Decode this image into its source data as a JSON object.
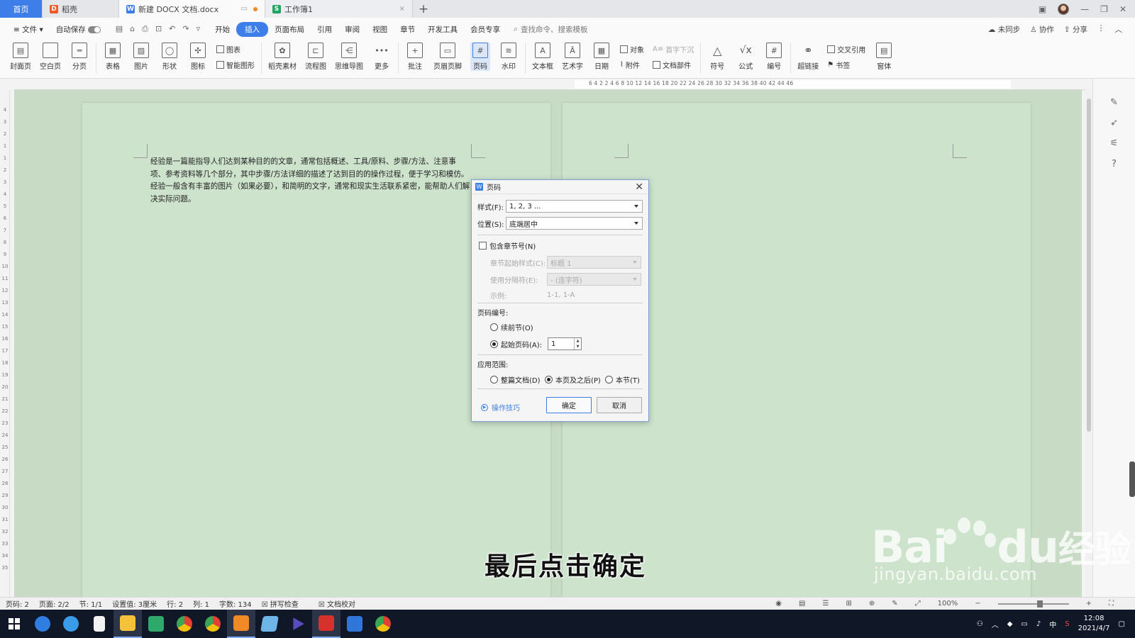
{
  "tabs": {
    "home": "首页",
    "straw": "稻壳",
    "doc": "新建 DOCX 文档.docx",
    "sheet": "工作簿1"
  },
  "menubar": {
    "file": "文件",
    "autosave": "自动保存",
    "items": [
      "开始",
      "插入",
      "页面布局",
      "引用",
      "审阅",
      "视图",
      "章节",
      "开发工具",
      "会员专享"
    ],
    "active_index": 1,
    "search_placeholder": "查找命令、搜索模板",
    "unsync": "未同步",
    "collab": "协作",
    "share": "分享"
  },
  "ribbon": {
    "cover": "封面页",
    "blank": "空白页",
    "pagebreak": "分页",
    "table": "表格",
    "picture": "图片",
    "shape": "形状",
    "icon": "图标",
    "chart": "图表",
    "smartart": "智能图形",
    "material": "稻壳素材",
    "flow": "流程图",
    "mindmap": "思维导图",
    "more": "更多",
    "comment": "批注",
    "header_footer": "页眉页脚",
    "page_number": "页码",
    "watermark": "水印",
    "textbox": "文本框",
    "wordart": "艺术字",
    "date": "日期",
    "object": "对象",
    "attachment": "附件",
    "dropcap": "首字下沉",
    "docparts": "文档部件",
    "symbol": "符号",
    "formula": "公式",
    "numbering": "编号",
    "hyperlink": "超链接",
    "crossref": "交叉引用",
    "bookmark": "书签",
    "window": "窗体"
  },
  "ruler": {
    "h_numbers": "6 4 2 2 4 6 8 10 12 14 16 18 20 22 24 26 28 30 32 34 36 38 40 42 44 46",
    "v_numbers": [
      "4",
      "3",
      "2",
      "1",
      "",
      "1",
      "2",
      "3",
      "4",
      "5",
      "6",
      "7",
      "8",
      "9",
      "10",
      "11",
      "12",
      "13",
      "14",
      "15",
      "16",
      "17",
      "18",
      "19",
      "20",
      "21",
      "22",
      "23",
      "24",
      "25",
      "26",
      "27",
      "28",
      "29",
      "30",
      "31",
      "32",
      "33",
      "34",
      "35"
    ]
  },
  "document": {
    "paragraph": "经验是一篇能指导人们达到某种目的的文章，通常包括概述、工具/原料、步骤/方法、注意事项、参考资料等几个部分，其中步骤/方法详细的描述了达到目的的操作过程，便于学习和模仿。经验一般含有丰富的图片（如果必要），和简明的文字，通常和现实生活联系紧密，能帮助人们解决实际问题。"
  },
  "dialog": {
    "title": "页码",
    "style_label": "样式(F):",
    "style_value": "1, 2, 3 ...",
    "position_label": "位置(S):",
    "position_value": "底端居中",
    "include_chapter": "包含章节号(N)",
    "chapter_style_label": "章节起始样式(C):",
    "chapter_style_value": "标题 1",
    "separator_label": "使用分隔符(E):",
    "separator_value": "-  (连字符)",
    "example_label": "示例:",
    "example_value": "1-1, 1-A",
    "numbering_label": "页码编号:",
    "continue_label": "续前节(O)",
    "start_label": "起始页码(A):",
    "start_value": "1",
    "apply_label": "应用范围:",
    "apply_whole": "整篇文档(D)",
    "apply_after": "本页及之后(P)",
    "apply_section": "本节(T)",
    "tips": "操作技巧",
    "ok": "确定",
    "cancel": "取消"
  },
  "caption": "最后点击确定",
  "watermark": {
    "brand": "Bai",
    "brand2": "du",
    "cn": "经验",
    "url": "jingyan.baidu.com"
  },
  "statusbar": {
    "page_num": "页码: 2",
    "pages": "页面: 2/2",
    "section": "节: 1/1",
    "setting": "设置值: 3厘米",
    "row": "行: 2",
    "col": "列: 1",
    "words": "字数: 134",
    "spell": "拼写检查",
    "proof": "文档校对",
    "zoom": "100%"
  },
  "taskbar": {
    "ime": "中",
    "time": "12:08",
    "date": "2021/4/7"
  },
  "colors": {
    "accent": "#3d7ee8",
    "canvas": "#c8dcc5",
    "page": "#cde3cc"
  }
}
